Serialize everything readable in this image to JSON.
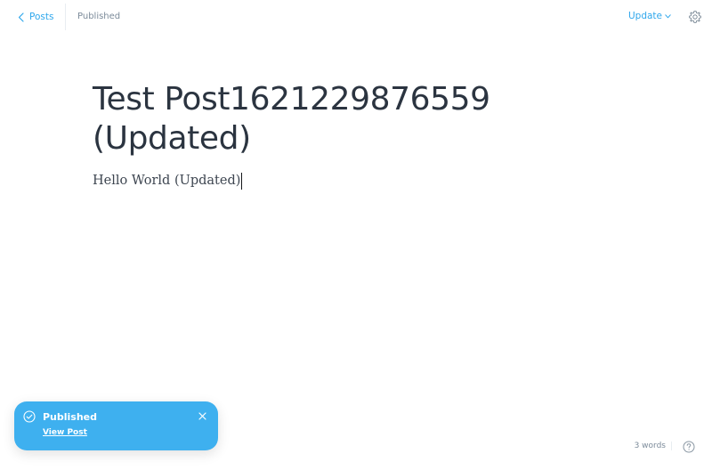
{
  "header": {
    "back_label": "Posts",
    "status": "Published",
    "update_label": "Update"
  },
  "post": {
    "title": "Test Post1621229876559 (Updated)",
    "body": "Hello World (Updated)"
  },
  "toast": {
    "title": "Published",
    "link": "View Post"
  },
  "footer": {
    "word_count": "3 words"
  },
  "colors": {
    "accent": "#2fa7ec",
    "toast_bg": "#3eb0ef",
    "title_text": "#2b3440",
    "muted_text": "#7c8b9a"
  },
  "icons": {
    "back": "chevron-left-icon",
    "update_dropdown": "chevron-down-icon",
    "settings": "gear-icon",
    "toast_status": "check-circle-icon",
    "toast_close": "close-icon",
    "help": "help-icon"
  }
}
